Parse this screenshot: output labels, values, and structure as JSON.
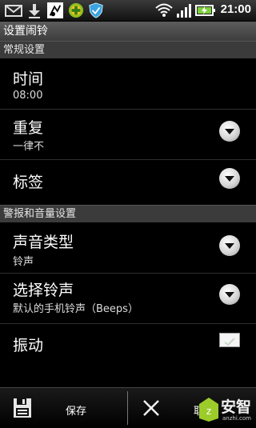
{
  "status_bar": {
    "time": "21:00",
    "icons": [
      "mail-icon",
      "download-icon",
      "app-icon",
      "plus-badge-icon",
      "shield-icon",
      "wifi-icon",
      "signal-icon",
      "battery-charging-icon"
    ]
  },
  "title": "设置闹铃",
  "sections": {
    "general": "常规设置",
    "alert_volume": "警报和音量设置"
  },
  "rows": {
    "time": {
      "title": "时间",
      "value": "08:00"
    },
    "repeat": {
      "title": "重复",
      "value": "一律不"
    },
    "label": {
      "title": "标签"
    },
    "sound_type": {
      "title": "声音类型",
      "value": "铃声"
    },
    "ringtone": {
      "title": "选择铃声",
      "value": "默认的手机铃声（Beeps）"
    },
    "vibrate": {
      "title": "振动"
    }
  },
  "bottom_bar": {
    "save_label": "保存",
    "cancel_label": "取"
  },
  "watermark": {
    "text": "安智",
    "subtext": "anzhi.com"
  }
}
